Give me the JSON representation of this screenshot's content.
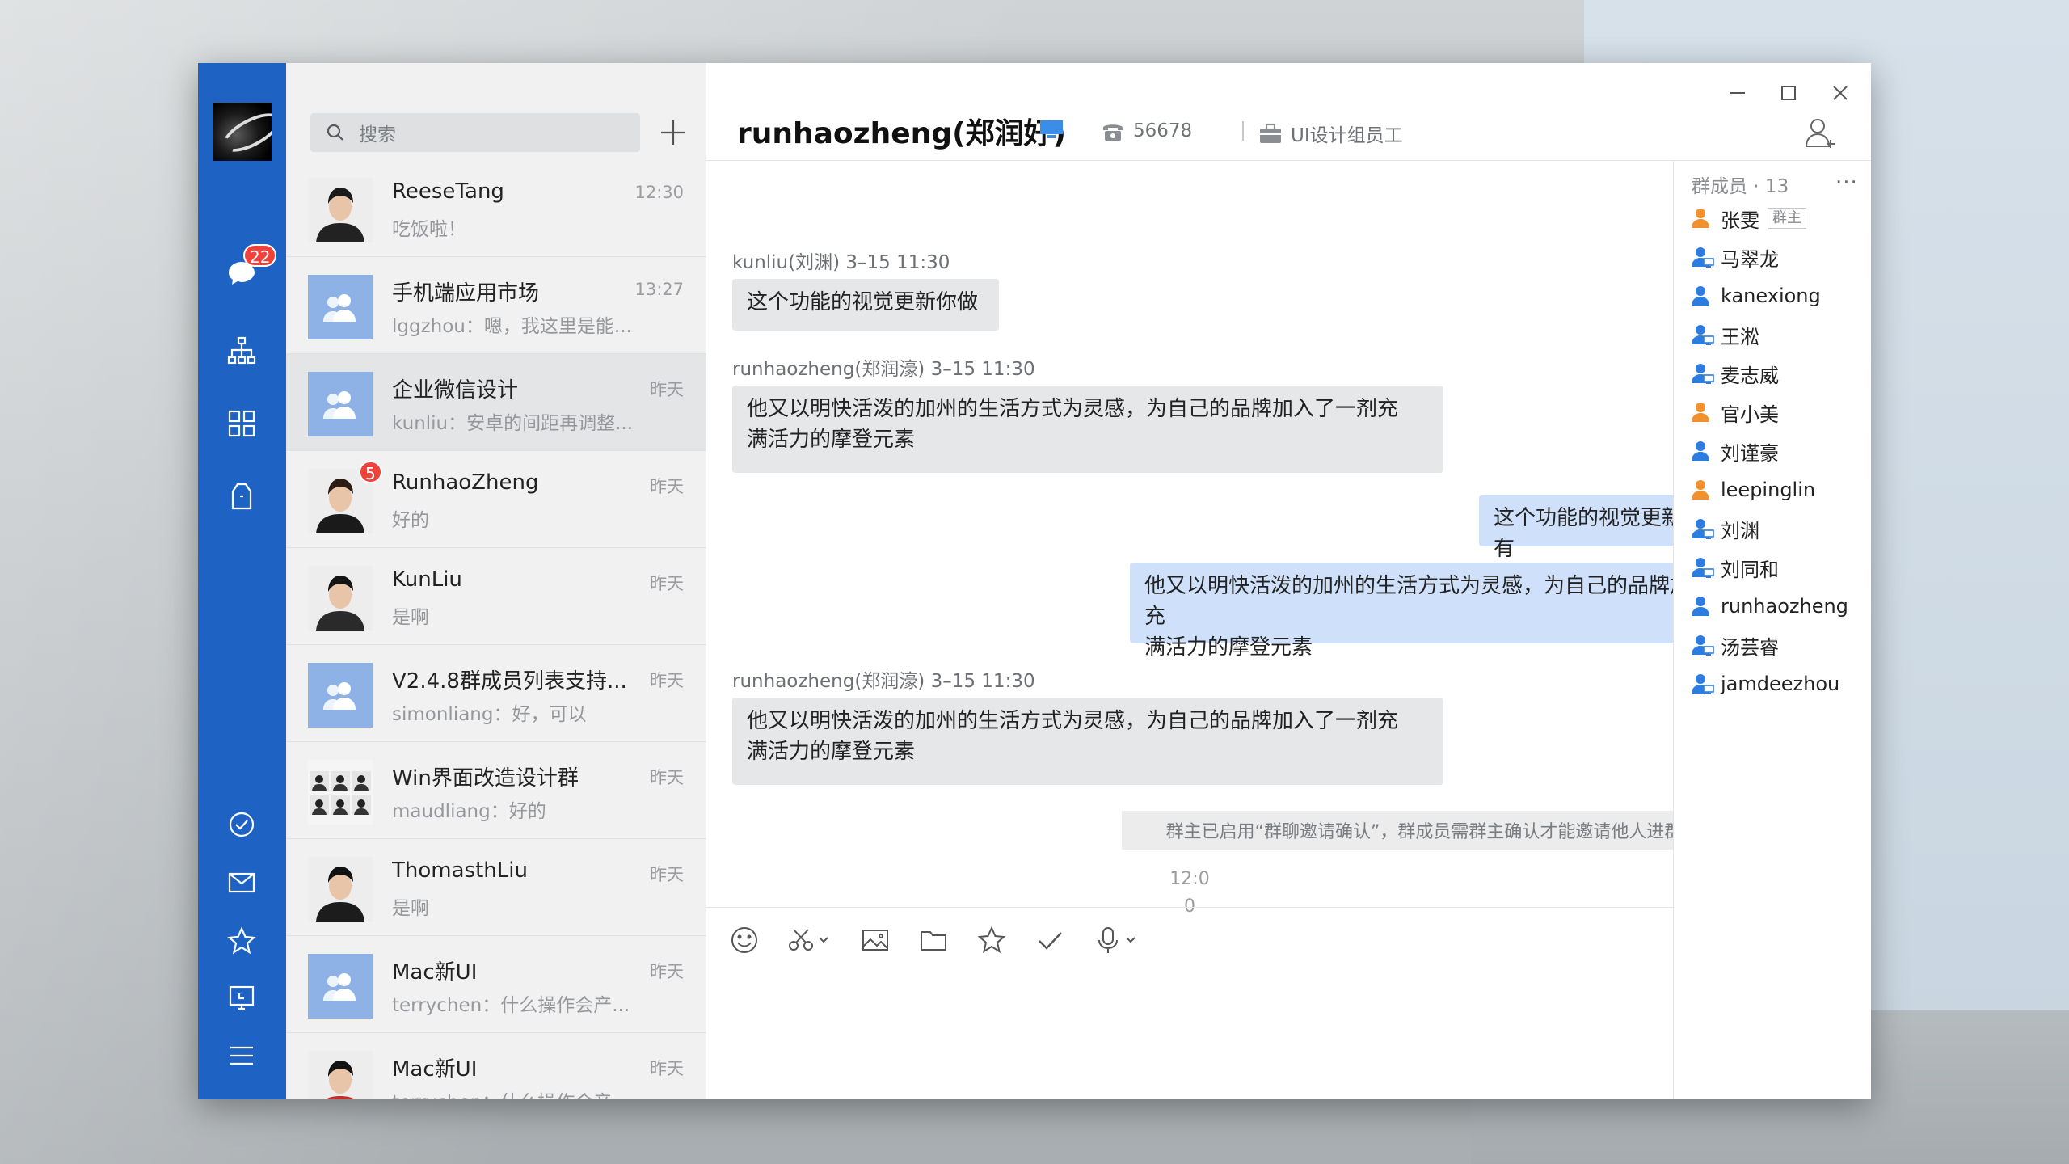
{
  "sidebar": {
    "unread_badge": "22"
  },
  "search": {
    "placeholder": "搜索"
  },
  "conversations": [
    {
      "name": "ReeseTang",
      "time": "12:30",
      "preview": "吃饭啦！",
      "avatar": "person-1"
    },
    {
      "name": "手机端应用市场",
      "time": "13:27",
      "preview": "lggzhou：嗯，我这里是能...",
      "avatar": "group"
    },
    {
      "name": "企业微信设计",
      "time": "昨天",
      "preview": "kunliu：安卓的间距再调整...",
      "avatar": "group"
    },
    {
      "name": "RunhaoZheng",
      "time": "昨天",
      "preview": "好的",
      "avatar": "person-2",
      "badge": "5"
    },
    {
      "name": "KunLiu",
      "time": "昨天",
      "preview": "是啊",
      "avatar": "person-3"
    },
    {
      "name": "V2.4.8群成员列表支持...",
      "time": "昨天",
      "preview": "simonliang：好，可以",
      "avatar": "group"
    },
    {
      "name": "Win界面改造设计群",
      "time": "昨天",
      "preview": "maudliang：好的",
      "avatar": "multi"
    },
    {
      "name": "ThomasthLiu",
      "time": "昨天",
      "preview": "是啊",
      "avatar": "person-4"
    },
    {
      "name": "Mac新UI",
      "time": "昨天",
      "preview": "terrychen：什么操作会产...",
      "avatar": "group"
    },
    {
      "name": "Mac新UI",
      "time": "昨天",
      "preview": "terrychen：什么操作会产...",
      "avatar": "person-5"
    }
  ],
  "chat": {
    "title": "runhaozheng(郑润好)",
    "extension": "56678",
    "department": "UI设计组员工",
    "messages": [
      {
        "sender": "kunliu(刘渊)  3–15 11:30",
        "text": "这个功能的视觉更新你做",
        "dir": "in"
      },
      {
        "sender": "runhaozheng(郑润濠)  3–15 11:30",
        "text1": "他又以明快活泼的加州的生活方式为灵感，为自己的品牌加入了一剂充",
        "text2": "满活力的摩登元素",
        "dir": "in"
      },
      {
        "text": "这个功能的视觉更新你做了吗？有",
        "dir": "out"
      },
      {
        "text1": "他又以明快活泼的加州的生活方式为灵感，为自己的品牌加入了一剂充",
        "text2": "满活力的摩登元素",
        "dir": "out"
      },
      {
        "sender": "runhaozheng(郑润濠)  3–15 11:30",
        "text1": "他又以明快活泼的加州的生活方式为灵感，为自己的品牌加入了一剂充",
        "text2": "满活力的摩登元素",
        "dir": "in"
      }
    ],
    "system_note": "群主已启用“群聊邀请确认”，群成员需群主确认才能邀请他人进群",
    "timestamp_line1": "12:0",
    "timestamp_line2": "0"
  },
  "members": {
    "header": "群成员 · 13",
    "more": "···",
    "owner_tag": "群主",
    "list": [
      {
        "name": "张雯",
        "type": "orange"
      },
      {
        "name": "马翠龙",
        "type": "blue-pc"
      },
      {
        "name": "kanexiong",
        "type": "blue"
      },
      {
        "name": "王淞",
        "type": "blue-pc"
      },
      {
        "name": "麦志威",
        "type": "blue-pc"
      },
      {
        "name": "官小美",
        "type": "orange"
      },
      {
        "name": "刘谨豪",
        "type": "blue"
      },
      {
        "name": "leepinglin",
        "type": "orange"
      },
      {
        "name": "刘渊",
        "type": "blue-pc"
      },
      {
        "name": "刘同和",
        "type": "blue-pc"
      },
      {
        "name": "runhaozheng",
        "type": "blue"
      },
      {
        "name": "汤芸睿",
        "type": "blue-pc"
      },
      {
        "name": "jamdeezhou",
        "type": "blue-pc"
      }
    ]
  },
  "colors": {
    "rail": "#1e63c4",
    "badge": "#f0413a",
    "bubble_out": "#cfe1fa",
    "bubble_in": "#e6e7e9",
    "member_orange": "#f0902e",
    "member_blue": "#2d7de0"
  }
}
